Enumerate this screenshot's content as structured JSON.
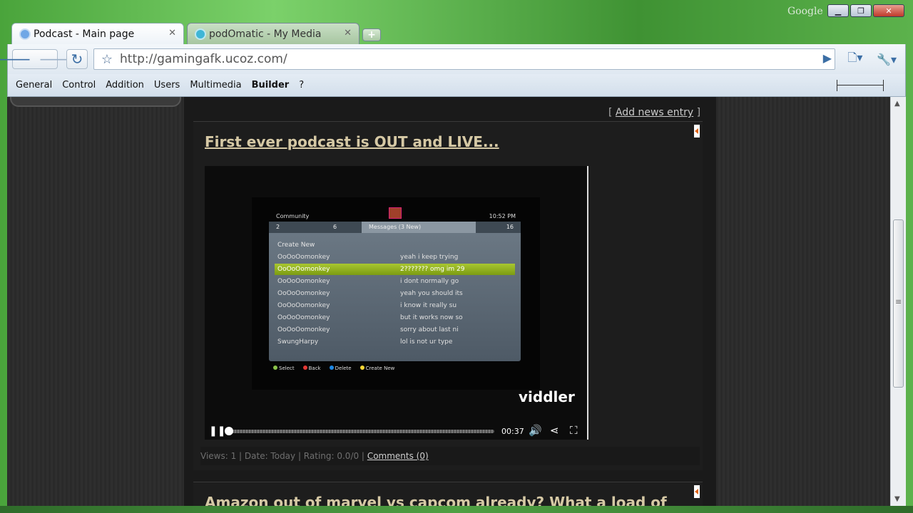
{
  "window": {
    "google_label": "Google",
    "controls": [
      "▁",
      "❐",
      "✕"
    ]
  },
  "tabs": [
    {
      "title": "Podcast - Main page",
      "active": true,
      "favicon_color": "#6fa7e6",
      "close": "✕"
    },
    {
      "title": "podOmatic - My Media",
      "active": false,
      "favicon_color": "#3fb6d6",
      "close": "✕"
    }
  ],
  "new_tab_label": "+",
  "toolbar": {
    "back_icon": "🡐",
    "forward_icon": "🡒",
    "reload_icon": "↻",
    "star_icon": "☆",
    "url": "http://gamingafk.ucoz.com/",
    "go_icon": "▶",
    "page_icon": "🗋▾",
    "wrench_icon": "🔧▾"
  },
  "bookmarks": [
    "General",
    "Control",
    "Addition",
    "Users",
    "Multimedia",
    "Builder",
    "?"
  ],
  "page": {
    "add_news_open": "[",
    "add_news": "Add news entry",
    "add_news_close": "]",
    "entry_title": "First ever podcast is OUT and LIVE...",
    "video": {
      "community_label": "Community",
      "clock": "10:52 PM",
      "tabs": [
        "2",
        "6",
        "Messages (3 New)",
        "16"
      ],
      "create_new": "Create New",
      "rows": [
        {
          "who": "OoOoOomonkey",
          "msg": "yeah i keep trying",
          "selected": false
        },
        {
          "who": "OoOoOomonkey",
          "msg": "2??????? omg im 29",
          "selected": true
        },
        {
          "who": "OoOoOomonkey",
          "msg": "i dont normally go",
          "selected": false
        },
        {
          "who": "OoOoOomonkey",
          "msg": "yeah you should its",
          "selected": false
        },
        {
          "who": "OoOoOomonkey",
          "msg": "i know it really su",
          "selected": false
        },
        {
          "who": "OoOoOomonkey",
          "msg": "but it works now so",
          "selected": false
        },
        {
          "who": "OoOoOomonkey",
          "msg": "sorry about last ni",
          "selected": false
        },
        {
          "who": "SwungHarpy",
          "msg": "lol is not ur type",
          "selected": false
        }
      ],
      "footer": [
        {
          "label": "Select",
          "color": "#8bc34a"
        },
        {
          "label": "Back",
          "color": "#e53935"
        },
        {
          "label": "Delete",
          "color": "#1e88e5"
        },
        {
          "label": "Create New",
          "color": "#fdd835"
        }
      ],
      "brand": "viddler",
      "time": "00:37",
      "progress": 0.0
    },
    "meta": {
      "stats": "Views: 1 | Date: Today | Rating: 0.0/0 |",
      "comments": "Comments (0)"
    },
    "next_entry_title": "Amazon out of marvel vs capcom already? What a load of"
  }
}
